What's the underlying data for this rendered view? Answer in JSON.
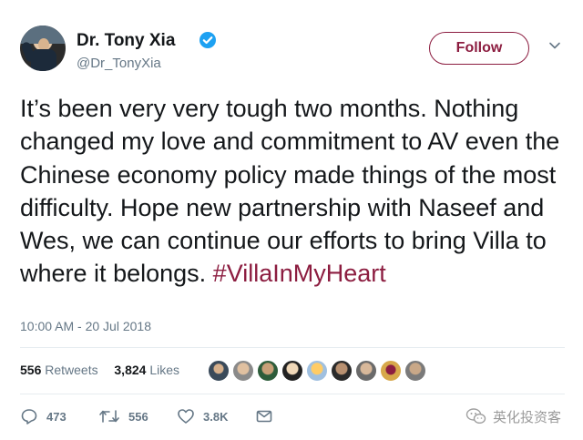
{
  "user": {
    "name": "Dr. Tony Xia",
    "handle": "@Dr_TonyXia",
    "verified": true
  },
  "follow_button": {
    "label": "Follow"
  },
  "tweet": {
    "text": "It’s been very very tough two months. Nothing changed my love and commitment to AV even the Chinese economy policy made things of the most difficulty. Hope new partnership with Naseef and Wes, we can continue our efforts to bring Villa to where it",
    "text_end": "belongs.",
    "hashtag": "#VillaInMyHeart",
    "timestamp": "10:00 AM - 20 Jul 2018"
  },
  "stats": {
    "retweets_count": "556",
    "retweets_label": "Retweets",
    "likes_count": "3,824",
    "likes_label": "Likes"
  },
  "actions": {
    "reply_count": "473",
    "retweet_count": "556",
    "like_count": "3.8K"
  },
  "colors": {
    "accent": "#8c1d40",
    "secondary_text": "#657786",
    "verified_blue": "#1da1f2"
  },
  "icons": [
    "verified-badge-icon",
    "chevron-down-icon",
    "reply-icon",
    "retweet-icon",
    "like-icon",
    "direct-message-icon",
    "wechat-icon"
  ],
  "watermark": {
    "text": "英化投资客"
  }
}
